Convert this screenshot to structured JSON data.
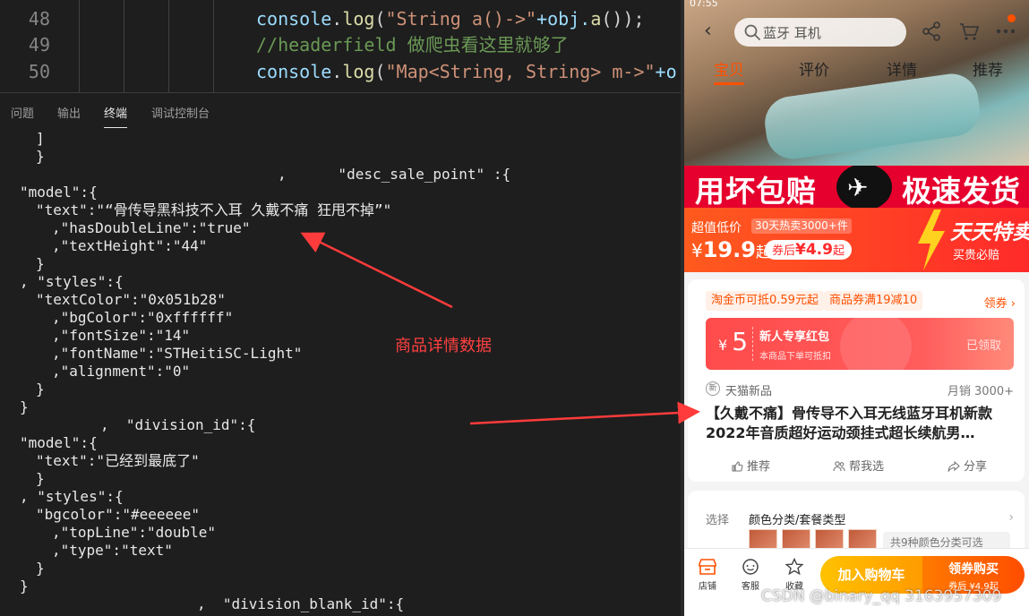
{
  "editor": {
    "lines": [
      {
        "number": "48",
        "parts": [
          {
            "t": "console",
            "c": "fn"
          },
          {
            "t": ".",
            "c": "op"
          },
          {
            "t": "log",
            "c": "call"
          },
          {
            "t": "(",
            "c": "op"
          },
          {
            "t": "\"String a()->\"",
            "c": "str"
          },
          {
            "t": "+obj.",
            "c": "fn"
          },
          {
            "t": "a",
            "c": "call"
          },
          {
            "t": "());",
            "c": "op"
          }
        ]
      },
      {
        "number": "49",
        "parts": [
          {
            "t": "//headerfield 做爬虫看这里就够了",
            "c": "cmt"
          }
        ]
      },
      {
        "number": "50",
        "parts": [
          {
            "t": "console",
            "c": "fn"
          },
          {
            "t": ".",
            "c": "op"
          },
          {
            "t": "log",
            "c": "call"
          },
          {
            "t": "(",
            "c": "op"
          },
          {
            "t": "\"Map<String, String> m->\"",
            "c": "str"
          },
          {
            "t": "+o",
            "c": "fn"
          }
        ]
      }
    ]
  },
  "panel": {
    "tabs": [
      "问题",
      "输出",
      "终端",
      "调试控制台"
    ],
    "active_tab": "终端"
  },
  "terminal": {
    "lines": [
      {
        "text": "]",
        "indent": 40
      },
      {
        "text": "}",
        "indent": 40
      },
      {
        "text": ",      \"desc_sale_point\" :{",
        "indent": 310
      },
      {
        "text": "\"model\":{",
        "indent": 22
      },
      {
        "text": "\"text\":\"“骨传导黑科技不入耳 久戴不痛 狂甩不掉”\"",
        "indent": 40
      },
      {
        "text": ",\"hasDoubleLine\":\"true\"",
        "indent": 58
      },
      {
        "text": ",\"textHeight\":\"44\"",
        "indent": 58
      },
      {
        "text": "}",
        "indent": 40
      },
      {
        "text": ", \"styles\":{",
        "indent": 22
      },
      {
        "text": "\"textColor\":\"0x051b28\"",
        "indent": 40
      },
      {
        "text": ",\"bgColor\":\"0xffffff\"",
        "indent": 58
      },
      {
        "text": ",\"fontSize\":\"14\"",
        "indent": 58
      },
      {
        "text": ",\"fontName\":\"STHeitiSC-Light\"",
        "indent": 58
      },
      {
        "text": ",\"alignment\":\"0\"",
        "indent": 58
      },
      {
        "text": "}",
        "indent": 40
      },
      {
        "text": "}",
        "indent": 22
      },
      {
        "text": ",  \"division_id\":{",
        "indent": 112
      },
      {
        "text": "\"model\":{",
        "indent": 22
      },
      {
        "text": "\"text\":\"已经到最底了\"",
        "indent": 40
      },
      {
        "text": "}",
        "indent": 40
      },
      {
        "text": ", \"styles\":{",
        "indent": 22
      },
      {
        "text": "\"bgcolor\":\"#eeeeee\"",
        "indent": 40
      },
      {
        "text": ",\"topLine\":\"double\"",
        "indent": 58
      },
      {
        "text": ",\"type\":\"text\"",
        "indent": 58
      },
      {
        "text": "}",
        "indent": 40
      },
      {
        "text": "}",
        "indent": 22
      },
      {
        "text": ",  \"division_blank_id\":{",
        "indent": 220
      }
    ]
  },
  "annotation": {
    "label": "商品详情数据",
    "color": "#ff3b3b"
  },
  "phone": {
    "status_text": "07:55",
    "search_placeholder": "蓝牙 耳机",
    "tabs": [
      "宝贝",
      "评价",
      "详情",
      "推荐"
    ],
    "active_tab": "宝贝",
    "banner": {
      "left": "用坏包赔",
      "right": "极速发货"
    },
    "price_band": {
      "tag": "超值低价",
      "hot": "30天热卖3000+件",
      "currency": "¥",
      "price": "19.9",
      "suffix": "起",
      "coupon_prefix": "券后",
      "coupon_price": "¥4.9",
      "coupon_suffix": "起",
      "daily_title": "天天特卖",
      "daily_sub": "买贵必赔"
    },
    "coupons": {
      "chip1": "淘金币可抵0.59元起",
      "chip2": "商品券满19减10",
      "get": "领券 ›"
    },
    "redpack": {
      "currency": "¥",
      "amount": "5",
      "title": "新人专享红包",
      "sub": "本商品下单可抵扣",
      "status": "已领取"
    },
    "shop": {
      "icon": "新",
      "label": "天猫新品",
      "monthly": "月销 3000+"
    },
    "product_title": "【久戴不痛】骨传导不入耳无线蓝牙耳机新款2022年音质超好运动颈挂式超长续航男…",
    "actions": [
      "推荐",
      "帮我选",
      "分享"
    ],
    "select": {
      "label": "选择",
      "value": "颜色分类/套餐类型",
      "chev": "›",
      "count": "共9种颜色分类可选"
    },
    "bottom": {
      "items": [
        "店铺",
        "客服",
        "收藏"
      ],
      "cart": "加入购物车",
      "buy": "领券购买",
      "buy_sub": "券后 ¥4.9起"
    },
    "accent": "#ff5000"
  },
  "watermark": "CSDN @binary_qq 3163957309"
}
